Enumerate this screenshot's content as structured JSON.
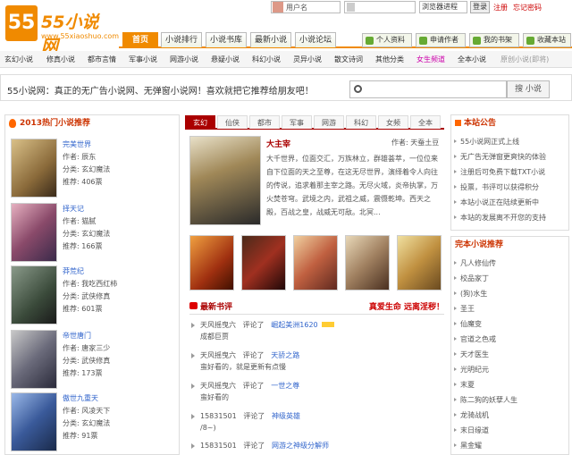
{
  "site": {
    "logo_num": "55",
    "logo_text": "55小说网",
    "logo_url": "www.55xiaoshuo.com"
  },
  "login": {
    "user_placeholder": "用户名",
    "browser_select": "浏览器进程",
    "login_btn": "登录",
    "register": "注册",
    "forgot": "忘记密码"
  },
  "nav": {
    "tabs": [
      "首页",
      "小说排行",
      "小说书库",
      "最新小说",
      "小说论坛"
    ],
    "active": 0
  },
  "user_buttons": [
    "个人资料",
    "申请作者",
    "我的书架",
    "收藏本站"
  ],
  "categories": [
    "玄幻小说",
    "修真小说",
    "都市言情",
    "军事小说",
    "网游小说",
    "悬疑小说",
    "科幻小说",
    "灵异小说",
    "散文诗词",
    "其他分类",
    "女生频道",
    "全本小说",
    "原创小说(即将)"
  ],
  "search": {
    "slogan": "55小说网：真正的无广告小说网、无弹窗小说网！喜欢就把它推荐给朋友吧！",
    "placeholder": "",
    "button": "搜 小说"
  },
  "hot": {
    "title": "2013热门小说推荐",
    "books": [
      {
        "title": "完美世界",
        "author": "作者: 辰东",
        "category": "分类: 玄幻魔法",
        "votes": "推荐: 406票"
      },
      {
        "title": "择天记",
        "author": "作者: 猫腻",
        "category": "分类: 玄幻魔法",
        "votes": "推荐: 166票"
      },
      {
        "title": "莽荒纪",
        "author": "作者: 我吃西红柿",
        "category": "分类: 武侠修真",
        "votes": "推荐: 601票"
      },
      {
        "title": "帝世唐门",
        "author": "作者: 唐家三少",
        "category": "分类: 武侠修真",
        "votes": "推荐: 173票"
      },
      {
        "title": "傲世九重天",
        "author": "作者: 风凌天下",
        "category": "分类: 玄幻魔法",
        "votes": "推荐: 91票"
      }
    ]
  },
  "center_tabs": [
    "玄幻",
    "仙侠",
    "都市",
    "军事",
    "网游",
    "科幻",
    "女频",
    "全本"
  ],
  "featured": {
    "title": "大主宰",
    "author": "作者: 天蚕土豆",
    "desc": "大千世界，位面交汇，万族林立，群雄荟萃，一位位来自下位面的天之至尊，在这无尽世界，演绎着令人向往的传说，追求着那主宰之路。无尽火域，炎帝执掌，万火焚苍穹。武境之内，武祖之威，震慑乾坤。西天之殿，百战之皇，战威无可敌。北冥..."
  },
  "reviews": {
    "title": "最新书评",
    "right_text": "真爱生命 远离淫秽！",
    "items": [
      {
        "user": "天风摇曳六",
        "action": "评论了",
        "book": "崛起美洲1620",
        "hot": true,
        "comment": "成都巨贾"
      },
      {
        "user": "天风摇曳六",
        "action": "评论了",
        "book": "天骄之路",
        "hot": false,
        "comment": "蛮好看的，就是更新有点慢"
      },
      {
        "user": "天风摇曳六",
        "action": "评论了",
        "book": "一世之尊",
        "hot": false,
        "comment": "蛮好看的"
      },
      {
        "user": "15831501",
        "action": "评论了",
        "book": "神级英雄",
        "hot": false,
        "comment": "/8~)"
      },
      {
        "user": "15831501",
        "action": "评论了",
        "book": "网游之神级分解师",
        "hot": false,
        "comment": ""
      }
    ]
  },
  "notice": {
    "title": "本站公告",
    "items": [
      "55小说网正式上线",
      "无广告无弹窗更爽快的体验",
      "注册后可免费下载TXT小说",
      "投票，书评可以获得积分",
      "本站小说正在陆续更新中",
      "本站的发展离不开您的支持"
    ]
  },
  "complete": {
    "title": "完本小说推荐",
    "items": [
      "凡人修仙传",
      "校品家丁",
      "(狗)水生",
      "圣王",
      "仙魔变",
      "官道之色戒",
      "天才医生",
      "光明纪元",
      "末夏",
      "陈二狗的妖孽人生",
      "龙骑战机",
      "末日缘道",
      "黑金耀"
    ]
  }
}
